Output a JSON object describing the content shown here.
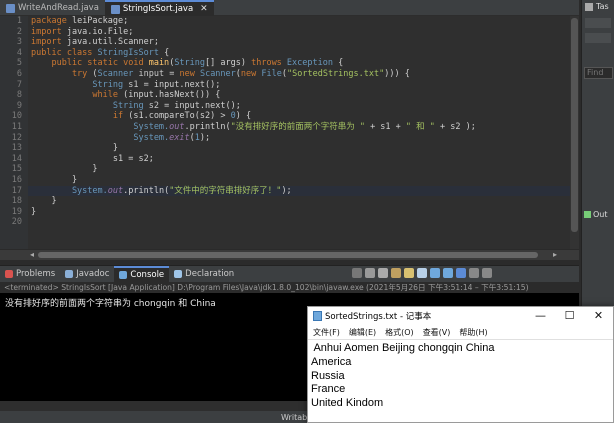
{
  "editor_tabs": [
    {
      "label": "WriteAndRead.java",
      "active": false
    },
    {
      "label": "StringIsSort.java",
      "active": true
    }
  ],
  "editor_tab_close": "✕",
  "code_lines": [
    [
      {
        "t": "package ",
        "c": "kw"
      },
      {
        "t": "leiPackage;",
        "c": ""
      }
    ],
    [
      {
        "t": "import ",
        "c": "kw"
      },
      {
        "t": "java.io.File;",
        "c": ""
      }
    ],
    [
      {
        "t": "import ",
        "c": "kw"
      },
      {
        "t": "java.util.Scanner;",
        "c": ""
      }
    ],
    [
      {
        "t": "public class ",
        "c": "kw"
      },
      {
        "t": "StringIsSort ",
        "c": "ty"
      },
      {
        "t": "{",
        "c": ""
      }
    ],
    [
      {
        "t": "    public static void ",
        "c": "kw"
      },
      {
        "t": "main",
        "c": "mth"
      },
      {
        "t": "(",
        "c": ""
      },
      {
        "t": "String",
        "c": "ty"
      },
      {
        "t": "[] args) ",
        "c": ""
      },
      {
        "t": "throws ",
        "c": "kw"
      },
      {
        "t": "Exception ",
        "c": "ty"
      },
      {
        "t": "{",
        "c": ""
      }
    ],
    [
      {
        "t": "        try ",
        "c": "kw"
      },
      {
        "t": "(",
        "c": ""
      },
      {
        "t": "Scanner ",
        "c": "ty"
      },
      {
        "t": "input ",
        "c": "var"
      },
      {
        "t": "= ",
        "c": ""
      },
      {
        "t": "new ",
        "c": "kw"
      },
      {
        "t": "Scanner",
        "c": "ty"
      },
      {
        "t": "(",
        "c": ""
      },
      {
        "t": "new ",
        "c": "kw"
      },
      {
        "t": "File",
        "c": "ty"
      },
      {
        "t": "(",
        "c": ""
      },
      {
        "t": "\"SortedStrings.txt\"",
        "c": "str"
      },
      {
        "t": "))) {",
        "c": ""
      }
    ],
    [
      {
        "t": "            String ",
        "c": "ty"
      },
      {
        "t": "s1 ",
        "c": "var"
      },
      {
        "t": "= input.next();",
        "c": ""
      }
    ],
    [
      {
        "t": "            while ",
        "c": "kw"
      },
      {
        "t": "(input.hasNext()) {",
        "c": ""
      }
    ],
    [
      {
        "t": "                String ",
        "c": "ty"
      },
      {
        "t": "s2 ",
        "c": "var"
      },
      {
        "t": "= input.next();",
        "c": ""
      }
    ],
    [
      {
        "t": "                if ",
        "c": "kw"
      },
      {
        "t": "(s1.compareTo(s2) > ",
        "c": ""
      },
      {
        "t": "0",
        "c": "num"
      },
      {
        "t": ") {",
        "c": ""
      }
    ],
    [
      {
        "t": "                    System.",
        "c": "ty"
      },
      {
        "t": "out",
        "c": "fld"
      },
      {
        "t": ".println(",
        "c": ""
      },
      {
        "t": "\"没有排好序的前面两个字符串为 \"",
        "c": "str"
      },
      {
        "t": " + s1 + ",
        "c": ""
      },
      {
        "t": "\" 和 \"",
        "c": "str"
      },
      {
        "t": " + s2 );",
        "c": ""
      }
    ],
    [
      {
        "t": "                    System.",
        "c": "ty"
      },
      {
        "t": "exit",
        "c": "fld"
      },
      {
        "t": "(",
        "c": ""
      },
      {
        "t": "1",
        "c": "num"
      },
      {
        "t": ");",
        "c": ""
      }
    ],
    [
      {
        "t": "                }",
        "c": ""
      }
    ],
    [
      {
        "t": "                s1 = s2;",
        "c": ""
      }
    ],
    [
      {
        "t": "            }",
        "c": ""
      }
    ],
    [
      {
        "t": "        }",
        "c": ""
      }
    ],
    [
      {
        "t": "        System.",
        "c": "ty"
      },
      {
        "t": "out",
        "c": "fld"
      },
      {
        "t": ".println(",
        "c": ""
      },
      {
        "t": "\"文件中的字符串排好序了！\"",
        "c": "str"
      },
      {
        "t": ");",
        "c": ""
      }
    ],
    [
      {
        "t": "    }",
        "c": ""
      }
    ],
    [
      {
        "t": "}",
        "c": ""
      }
    ],
    [
      {
        "t": "",
        "c": ""
      }
    ]
  ],
  "view_tabs": [
    {
      "label": "Problems",
      "active": false,
      "color": "#d9534f"
    },
    {
      "label": "Javadoc",
      "active": false,
      "color": "#8bb0d8"
    },
    {
      "label": "Console",
      "active": true,
      "color": "#6fa8dc"
    },
    {
      "label": "Declaration",
      "active": false,
      "color": "#9fc5e8"
    }
  ],
  "console_status": "<terminated> StringIsSort [Java Application] D:\\Program Files\\Java\\jdk1.8.0_102\\bin\\javaw.exe  (2021年5月26日 下午3:51:14 – 下午3:51:15)",
  "console_output": "没有排好序的前面两个字符串为 chongqin 和 China",
  "status_bar_text": "Writab",
  "right_panel": {
    "tab": "Tas",
    "find_placeholder": "Find",
    "outline_label": "Out"
  },
  "notepad": {
    "title": "SortedStrings.txt - 记事本",
    "menu": [
      "文件(F)",
      "编辑(E)",
      "格式(O)",
      "查看(V)",
      "帮助(H)"
    ],
    "lines": [
      " Anhui Aomen Beijing chongqin China",
      "America",
      "Russia",
      "France",
      "United Kindom"
    ],
    "minimize": "—",
    "maximize": "☐",
    "close": "✕"
  }
}
